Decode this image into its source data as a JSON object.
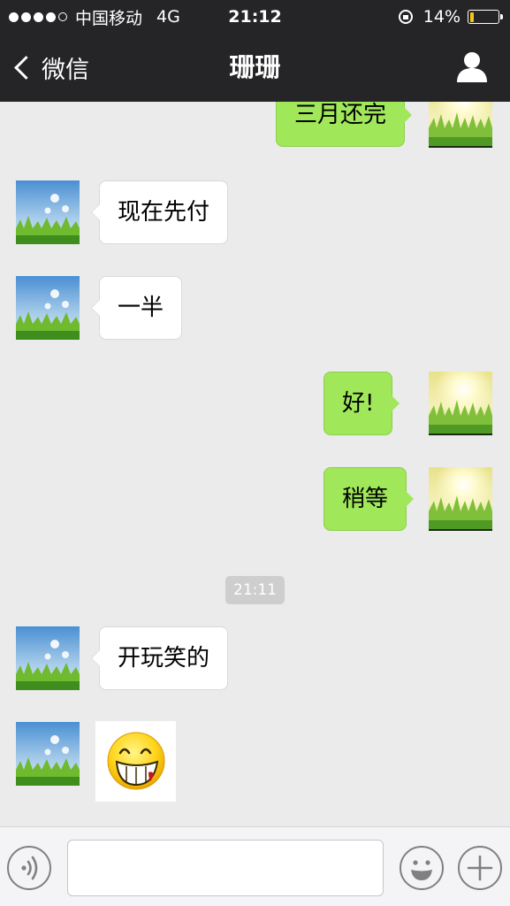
{
  "status_bar": {
    "carrier": "中国移动",
    "network": "4G",
    "time": "21:12",
    "battery_percent": "14%",
    "battery_level": 0.14,
    "battery_color": "#f5c518"
  },
  "nav": {
    "back_label": "微信",
    "title": "珊珊",
    "profile_icon": "person-icon"
  },
  "messages": [
    {
      "direction": "out",
      "text": "三月还完"
    },
    {
      "direction": "in",
      "text": "现在先付"
    },
    {
      "direction": "in",
      "text": "一半"
    },
    {
      "direction": "out",
      "text": "好!"
    },
    {
      "direction": "out",
      "text": "稍等"
    },
    {
      "type": "timestamp",
      "text": "21:11"
    },
    {
      "direction": "in",
      "text": "开玩笑的"
    },
    {
      "direction": "in",
      "type": "sticker",
      "icon": "laughing-face-sticker"
    }
  ],
  "input_bar": {
    "voice_icon": "voice-icon",
    "emoji_icon": "emoji-icon",
    "plus_icon": "plus-icon",
    "value": ""
  },
  "colors": {
    "outgoing_bubble": "#a0e75a",
    "incoming_bubble": "#ffffff",
    "chat_background": "#ebebeb",
    "header": "#252528"
  }
}
